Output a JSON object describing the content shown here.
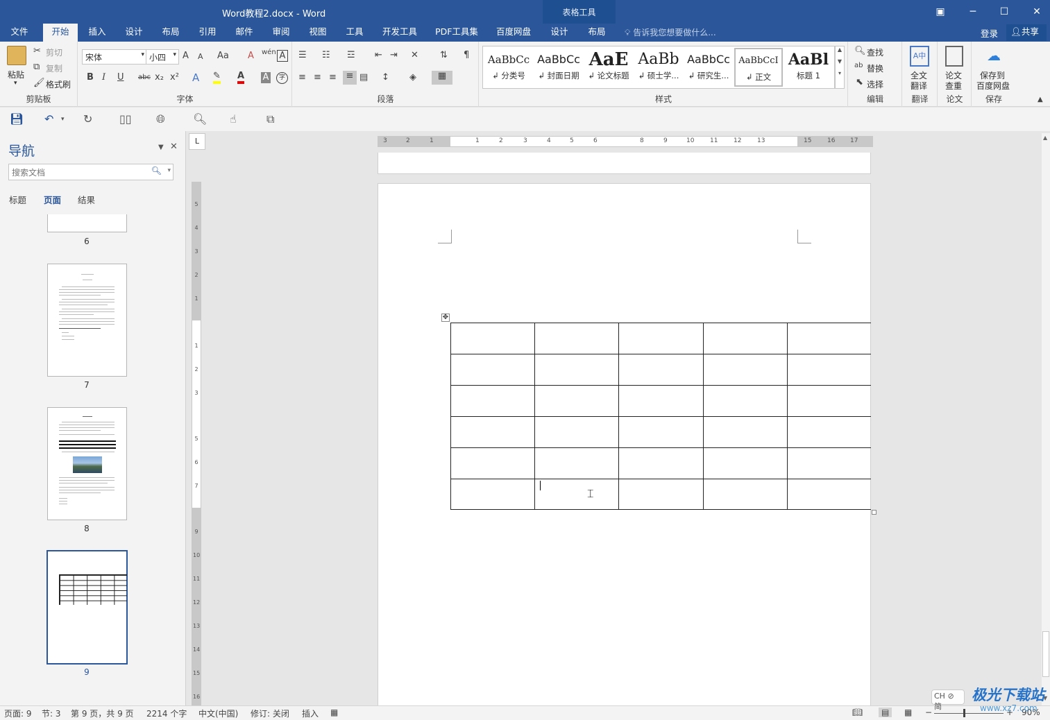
{
  "titlebar": {
    "doc_title": "Word教程2.docx - Word",
    "context_tab": "表格工具",
    "restore_icon": "ribbon-display-icon",
    "min": "─",
    "max": "☐",
    "close": "✕"
  },
  "tabs": [
    "文件",
    "开始",
    "插入",
    "设计",
    "布局",
    "引用",
    "邮件",
    "审阅",
    "视图",
    "工具",
    "开发工具",
    "PDF工具集",
    "百度网盘",
    "设计",
    "布局"
  ],
  "active_tab": "开始",
  "tellme": "告诉我您想要做什么...",
  "login": "登录",
  "share": "共享",
  "ribbon": {
    "clipboard": {
      "paste": "粘贴",
      "cut": "剪切",
      "copy": "复制",
      "format_painter": "格式刷",
      "label": "剪贴板"
    },
    "font": {
      "name": "宋体",
      "size": "小四",
      "bold": "B",
      "italic": "I",
      "underline": "U",
      "strike": "abc",
      "sub": "x₂",
      "sup": "x²",
      "grow": "A",
      "shrink": "A",
      "case": "Aa",
      "clear": "A",
      "phonetic": "wén",
      "border": "A",
      "color_letter": "A",
      "shading": "A",
      "enclose": "字",
      "label": "字体"
    },
    "paragraph": {
      "label": "段落"
    },
    "styles": {
      "label": "样式",
      "items": [
        {
          "sample": "AaBbCc",
          "name": "↲ 分类号"
        },
        {
          "sample": "AaBbCc",
          "name": "↲ 封面日期"
        },
        {
          "sample": "AaE",
          "name": "↲ 论文标题"
        },
        {
          "sample": "AaBb",
          "name": "↲ 硕士学..."
        },
        {
          "sample": "AaBbCc",
          "name": "↲ 研究生..."
        },
        {
          "sample": "AaBbCcI",
          "name": "↲ 正文"
        },
        {
          "sample": "AaBl",
          "name": "标题 1"
        }
      ]
    },
    "editing": {
      "find": "查找",
      "replace": "替换",
      "select": "选择",
      "label": "编辑"
    },
    "translate": {
      "btn": "全文\n翻译",
      "btn1": "全文",
      "btn2": "翻译",
      "label": "翻译"
    },
    "paper": {
      "btn1": "论文",
      "btn2": "查重",
      "label": "论文"
    },
    "save": {
      "btn1": "保存到",
      "btn2": "百度网盘",
      "label": "保存"
    }
  },
  "nav": {
    "title": "导航",
    "search_placeholder": "搜索文档",
    "tabs": [
      "标题",
      "页面",
      "结果"
    ],
    "active_tab": "页面",
    "pages": [
      "6",
      "7",
      "8",
      "9"
    ],
    "selected_page": "9"
  },
  "ruler": {
    "vruler_tab": "L",
    "h_numbers": [
      "3",
      "2",
      "1",
      "1",
      "2",
      "3",
      "4",
      "5",
      "6",
      "8",
      "9",
      "10",
      "11",
      "12",
      "13",
      "15",
      "16",
      "17"
    ],
    "v_numbers": [
      "5",
      "4",
      "3",
      "2",
      "1",
      "1",
      "2",
      "3",
      "5",
      "6",
      "7",
      "9",
      "10",
      "11",
      "12",
      "13",
      "14",
      "15",
      "16"
    ]
  },
  "table": {
    "rows": 6,
    "cols": 5
  },
  "status": {
    "page": "页面: 9",
    "section": "节: 3",
    "page_of": "第 9 页，共 9 页",
    "words": "2214 个字",
    "lang": "中文(中国)",
    "track": "修订: 关闭",
    "insert": "插入",
    "zoom": "90%"
  },
  "watermark": {
    "text": "极光下载站",
    "url": "www.xz7.com",
    "badge": "CH ⊘ 简"
  },
  "colors": {
    "accent": "#2b579a"
  }
}
